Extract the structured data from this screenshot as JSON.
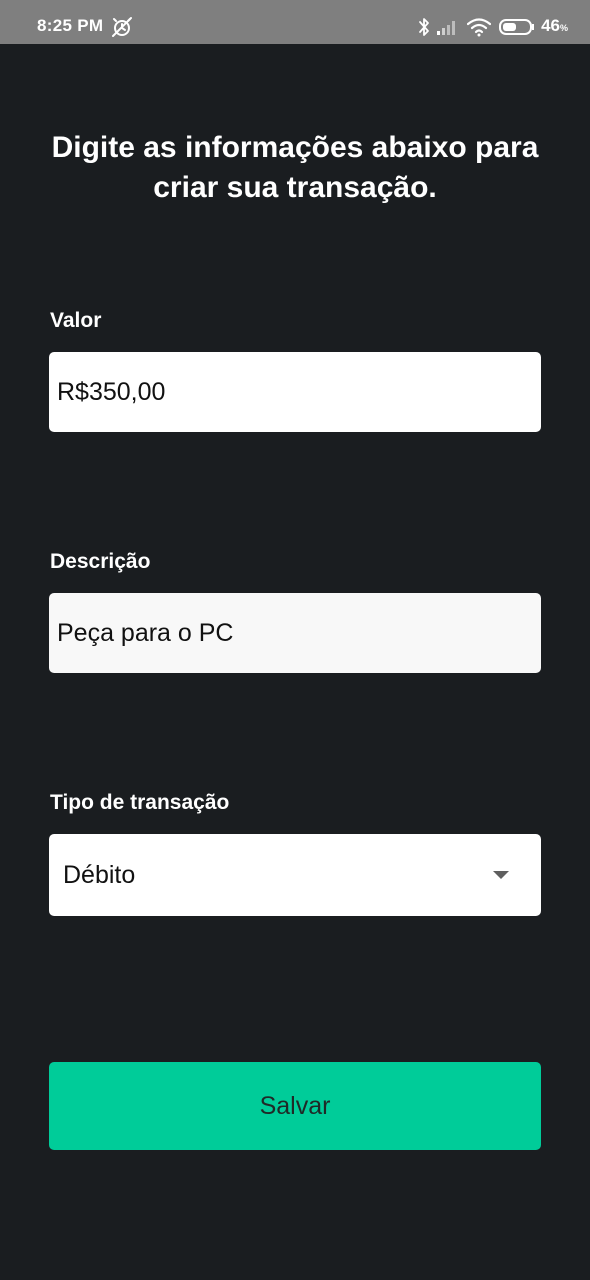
{
  "status_bar": {
    "time": "8:25 PM",
    "battery": "46",
    "battery_unit": "%",
    "icons": [
      "alarm-off-icon",
      "bluetooth-icon",
      "signal-icon",
      "wifi-icon",
      "battery-icon"
    ]
  },
  "title": "Digite as informações abaixo para criar sua transação.",
  "form": {
    "valor": {
      "label": "Valor",
      "value": "R$350,00"
    },
    "descricao": {
      "label": "Descrição",
      "value": "Peça para o PC"
    },
    "tipo": {
      "label": "Tipo de transação",
      "selected": "Débito"
    }
  },
  "save_label": "Salvar",
  "colors": {
    "background": "#1a1d20",
    "status_bar": "#7f7f7f",
    "accent": "#00cc99",
    "input_bg": "#ffffff"
  }
}
